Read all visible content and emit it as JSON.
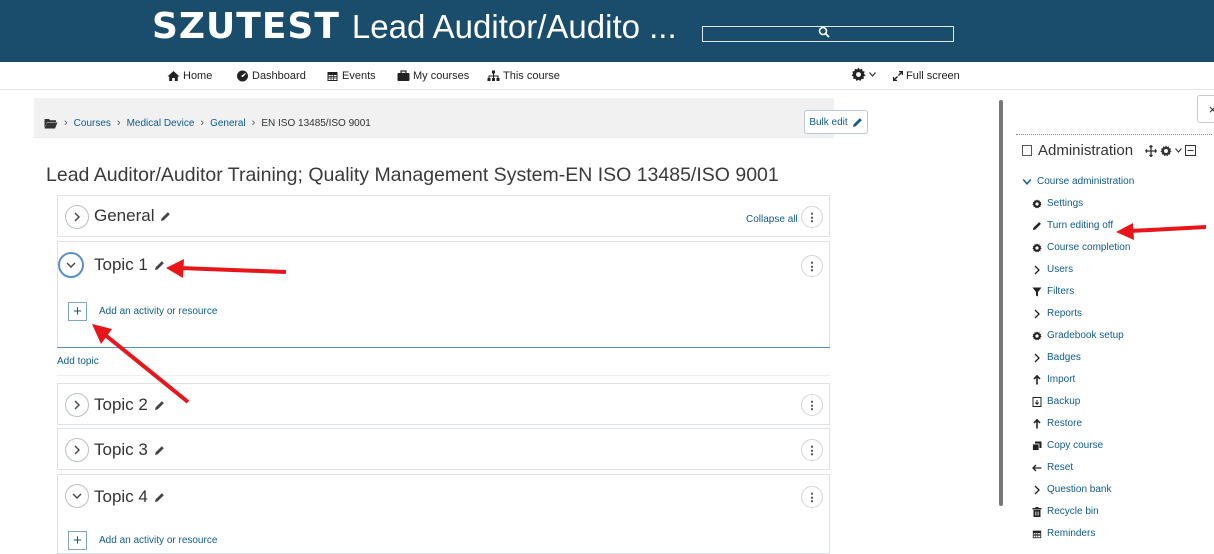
{
  "header": {
    "logo": "SZUTEST",
    "title": "Lead Auditor/Audito ...",
    "search_placeholder": ""
  },
  "nav": {
    "home": "Home",
    "dashboard": "Dashboard",
    "events": "Events",
    "my_courses": "My courses",
    "this_course": "This course",
    "full_screen": "Full screen"
  },
  "breadcrumb": {
    "items": [
      "Courses",
      "Medical Device",
      "General",
      "EN ISO 13485/ISO 9001"
    ],
    "separator": "›"
  },
  "bulk_edit": "Bulk edit",
  "page_title": "Lead Auditor/Auditor Training; Quality Management System-EN ISO 13485/ISO 9001",
  "collapse_all": "Collapse all",
  "sections": [
    {
      "title": "General"
    },
    {
      "title": "Topic 1",
      "add_activity": "Add an activity or resource"
    },
    {
      "title": "Topic 2"
    },
    {
      "title": "Topic 3"
    },
    {
      "title": "Topic 4",
      "add_activity": "Add an activity or resource"
    }
  ],
  "add_topic": "Add topic",
  "kebab_glyph": "⋮",
  "drawer": {
    "close_glyph": "×",
    "administration": "Administration",
    "course_administration": "Course administration",
    "items": [
      {
        "label": "Settings",
        "icon": "gear-icon"
      },
      {
        "label": "Turn editing off",
        "icon": "pencil-icon"
      },
      {
        "label": "Course completion",
        "icon": "gear-icon"
      },
      {
        "label": "Users",
        "icon": "chevron-right-icon"
      },
      {
        "label": "Filters",
        "icon": "filter-icon"
      },
      {
        "label": "Reports",
        "icon": "chevron-right-icon"
      },
      {
        "label": "Gradebook setup",
        "icon": "gear-icon"
      },
      {
        "label": "Badges",
        "icon": "chevron-right-icon"
      },
      {
        "label": "Import",
        "icon": "import-icon"
      },
      {
        "label": "Backup",
        "icon": "backup-icon"
      },
      {
        "label": "Restore",
        "icon": "restore-icon"
      },
      {
        "label": "Copy course",
        "icon": "copy-icon"
      },
      {
        "label": "Reset",
        "icon": "arrow-left-icon"
      },
      {
        "label": "Question bank",
        "icon": "chevron-right-icon"
      },
      {
        "label": "Recycle bin",
        "icon": "trash-icon"
      },
      {
        "label": "Reminders",
        "icon": "calendar-icon"
      }
    ]
  },
  "colors": {
    "header_bg": "#1a4d6b",
    "link": "#0f5c8c",
    "annotation_arrow": "#e8161b"
  }
}
